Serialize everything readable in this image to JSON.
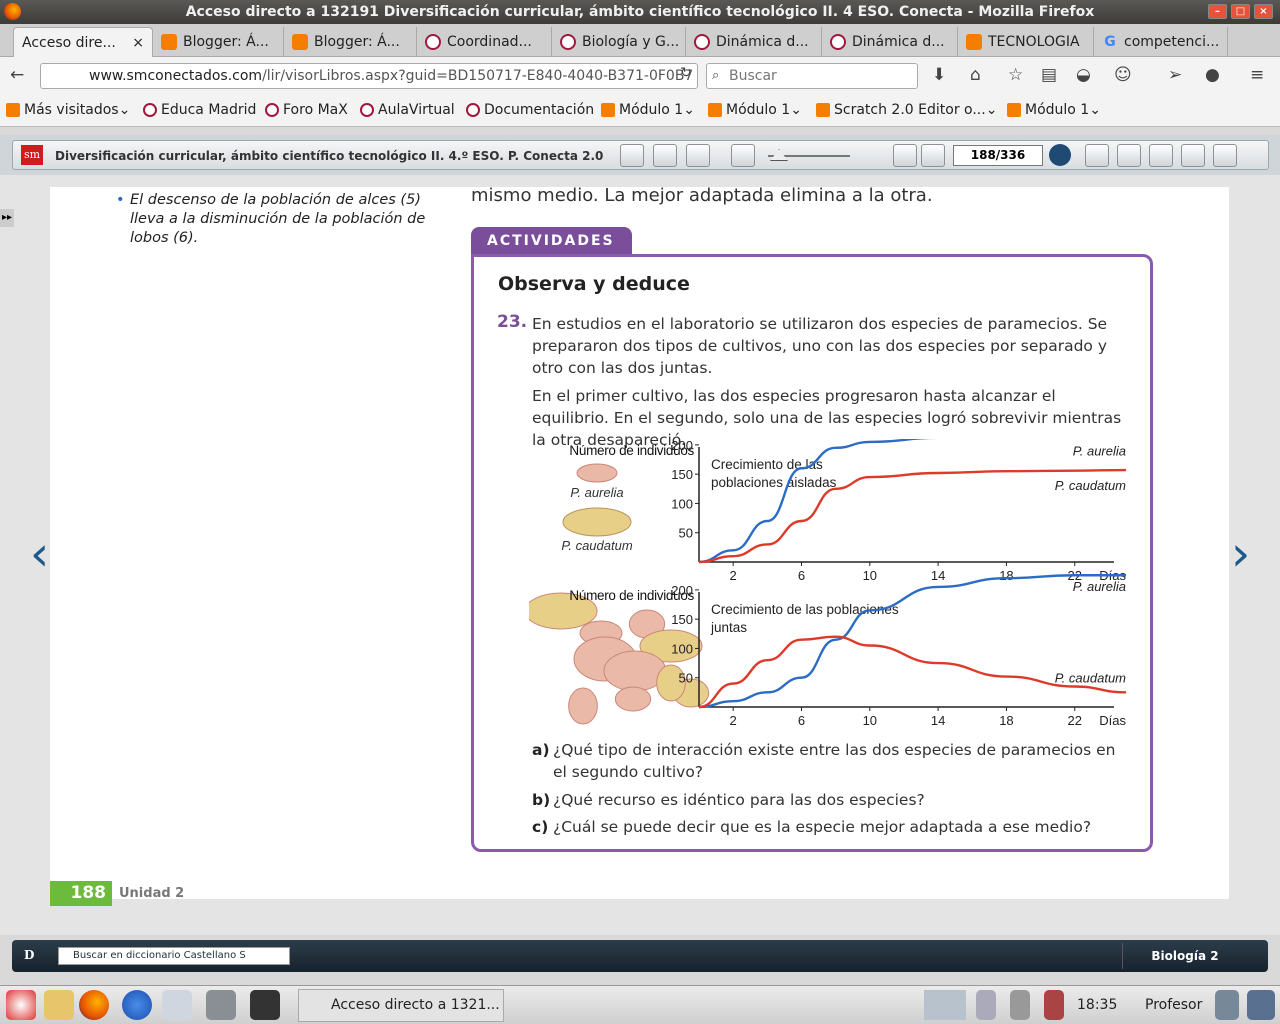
{
  "window": {
    "title": "Acceso directo a 132191 Diversificación curricular, ámbito científico tecnológico II. 4 ESO. Conecta - Mozilla Firefox"
  },
  "tabs": [
    {
      "label": "Acceso dire...",
      "icon": "firefox-icon"
    },
    {
      "label": "Blogger: Á...",
      "icon": "blogger-icon"
    },
    {
      "label": "Blogger: Á...",
      "icon": "blogger-icon"
    },
    {
      "label": "Coordinad...",
      "icon": "spinner-icon"
    },
    {
      "label": "Biología y G...",
      "icon": "spinner-icon"
    },
    {
      "label": "Dinámica d...",
      "icon": "spinner-icon"
    },
    {
      "label": "Dinámica d...",
      "icon": "spinner-icon"
    },
    {
      "label": "TECNOLOGIA",
      "icon": "blogger-icon"
    },
    {
      "label": "competenci...",
      "icon": "google-icon"
    }
  ],
  "tab_close": "×",
  "new_tab": "+",
  "nav": {
    "url_domain": "www.smconectados.com",
    "url_path": "/lir/visorLibros.aspx?guid=BD150717-E840-4040-B371-0F0B7",
    "search_placeholder": "Buscar"
  },
  "bookmarks": [
    {
      "label": "Más visitados",
      "dropdown": true
    },
    {
      "label": "Educa Madrid"
    },
    {
      "label": "Foro MaX"
    },
    {
      "label": "AulaVirtual"
    },
    {
      "label": "Documentación"
    },
    {
      "label": "Módulo 1",
      "dropdown": true
    },
    {
      "label": "Módulo 1",
      "dropdown": true
    },
    {
      "label": "Scratch 2.0 Editor o...",
      "dropdown": true
    },
    {
      "label": "Módulo 1",
      "dropdown": true
    }
  ],
  "reader": {
    "logo": "sm",
    "title": "Diversificación curricular, ámbito científico tecnológico II. 4.º ESO. P. Conecta 2.0",
    "page_indicator": "188/336"
  },
  "page": {
    "left_bullet": "El descenso de la población de alces (5) lleva a la disminución de la población de lobos (6).",
    "top_text": "mismo medio. La mejor adaptada elimina a la otra.",
    "activity_label": "ACTIVIDADES",
    "section_title": "Observa y deduce",
    "question_number": "23.",
    "paragraph1": "En estudios en el laboratorio se utilizaron dos especies de paramecios. Se prepararon dos tipos de cultivos, uno con las dos especies por separado y otro con las dos juntas.",
    "paragraph2": "En el primer cultivo, las dos especies progresaron hasta alcanzar el equilibrio. En el segundo, solo una de las especies logró sobrevivir mientras la otra desapareció.",
    "sub_questions": [
      {
        "letter": "a)",
        "text": "¿Qué tipo de interacción existe entre las dos especies de paramecios en el segundo cultivo?"
      },
      {
        "letter": "b)",
        "text": "¿Qué recurso es idéntico para las dos especies?"
      },
      {
        "letter": "c)",
        "text": "¿Cuál se puede decir que es la especie mejor adaptada a ese medio?"
      }
    ],
    "footer_page": "188",
    "footer_unit": "Unidad 2"
  },
  "chart_data": [
    {
      "type": "line",
      "title": "Crecimiento de las poblaciones aisladas",
      "ylabel": "Número de individuos",
      "xlabel": "Días",
      "x_ticks": [
        2,
        6,
        10,
        14,
        18,
        22
      ],
      "y_ticks": [
        50,
        100,
        150,
        200
      ],
      "xlim": [
        0,
        25
      ],
      "ylim": [
        0,
        250
      ],
      "image_labels": [
        "P. aurelia",
        "P. caudatum"
      ],
      "series": [
        {
          "name": "P. aurelia",
          "color": "#2b6cc4",
          "x": [
            0,
            2,
            4,
            6,
            8,
            10,
            14,
            18,
            22,
            25
          ],
          "y": [
            0,
            20,
            70,
            160,
            195,
            205,
            212,
            215,
            216,
            216
          ]
        },
        {
          "name": "P. caudatum",
          "color": "#dd3a2a",
          "x": [
            0,
            2,
            4,
            6,
            8,
            10,
            14,
            18,
            22,
            25
          ],
          "y": [
            0,
            10,
            30,
            70,
            125,
            145,
            152,
            155,
            156,
            157
          ]
        }
      ]
    },
    {
      "type": "line",
      "title": "Crecimiento de las poblaciones juntas",
      "ylabel": "Número de individuos",
      "xlabel": "Días",
      "x_ticks": [
        2,
        6,
        10,
        14,
        18,
        22
      ],
      "y_ticks": [
        50,
        100,
        150,
        200
      ],
      "xlim": [
        0,
        25
      ],
      "ylim": [
        0,
        250
      ],
      "series": [
        {
          "name": "P. aurelia",
          "color": "#2b6cc4",
          "x": [
            0,
            2,
            4,
            6,
            8,
            10,
            14,
            18,
            22,
            25
          ],
          "y": [
            0,
            10,
            25,
            50,
            115,
            165,
            205,
            220,
            225,
            225
          ]
        },
        {
          "name": "P. caudatum",
          "color": "#dd3a2a",
          "x": [
            0,
            2,
            4,
            6,
            8,
            10,
            14,
            18,
            22,
            25
          ],
          "y": [
            0,
            40,
            80,
            115,
            120,
            105,
            75,
            52,
            35,
            25
          ]
        }
      ]
    }
  ],
  "bottom": {
    "dictionary_placeholder": "Buscar en diccionario Castellano S",
    "book_name": "Biología 2",
    "dict_logo": "D"
  },
  "taskbar": {
    "window_label": "Acceso directo a 1321...",
    "clock": "18:35",
    "user": "Profesor"
  }
}
